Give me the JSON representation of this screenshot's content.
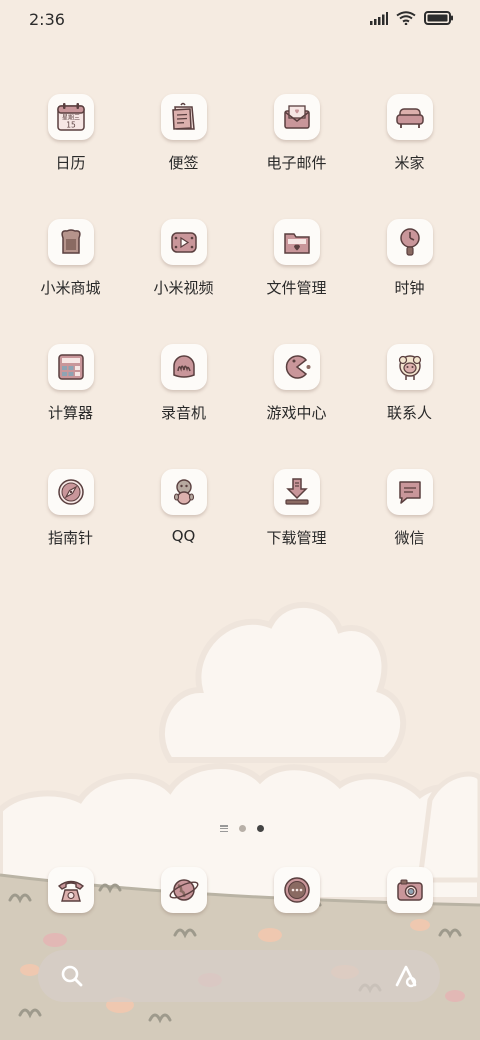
{
  "status": {
    "time": "2:36"
  },
  "apps": [
    {
      "label": "日历",
      "icon": "calendar-icon",
      "cal_top": "星期三",
      "cal_day": "15"
    },
    {
      "label": "便签",
      "icon": "notes-icon"
    },
    {
      "label": "电子邮件",
      "icon": "email-icon"
    },
    {
      "label": "米家",
      "icon": "mi-home-icon"
    },
    {
      "label": "小米商城",
      "icon": "mi-store-icon"
    },
    {
      "label": "小米视频",
      "icon": "mi-video-icon"
    },
    {
      "label": "文件管理",
      "icon": "file-manager-icon"
    },
    {
      "label": "时钟",
      "icon": "clock-icon"
    },
    {
      "label": "计算器",
      "icon": "calculator-icon"
    },
    {
      "label": "录音机",
      "icon": "recorder-icon"
    },
    {
      "label": "游戏中心",
      "icon": "game-center-icon"
    },
    {
      "label": "联系人",
      "icon": "contacts-icon"
    },
    {
      "label": "指南针",
      "icon": "compass-icon"
    },
    {
      "label": "QQ",
      "icon": "qq-icon"
    },
    {
      "label": "下载管理",
      "icon": "download-manager-icon"
    },
    {
      "label": "微信",
      "icon": "wechat-icon"
    }
  ],
  "page_indicator": {
    "pages": 3,
    "active": 2
  },
  "dock": [
    {
      "icon": "phone-icon"
    },
    {
      "icon": "browser-icon"
    },
    {
      "icon": "messages-icon"
    },
    {
      "icon": "camera-icon"
    }
  ],
  "search_bar": {
    "left_icon": "search-icon",
    "right_icon": "assistant-icon"
  },
  "colors": {
    "background": "#f5ebe1",
    "tile": "#fdfbf8",
    "icon_pink": "#c9969a",
    "icon_dark": "#5a3f3f"
  }
}
